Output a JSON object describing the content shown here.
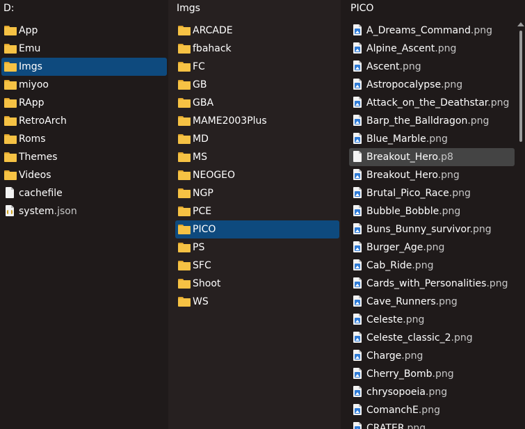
{
  "root": {
    "title": "D:",
    "items": [
      {
        "name": "App",
        "ext": "",
        "type": "folder",
        "state": ""
      },
      {
        "name": "Emu",
        "ext": "",
        "type": "folder",
        "state": ""
      },
      {
        "name": "Imgs",
        "ext": "",
        "type": "folder",
        "state": "selected"
      },
      {
        "name": "miyoo",
        "ext": "",
        "type": "folder",
        "state": ""
      },
      {
        "name": "RApp",
        "ext": "",
        "type": "folder",
        "state": ""
      },
      {
        "name": "RetroArch",
        "ext": "",
        "type": "folder",
        "state": ""
      },
      {
        "name": "Roms",
        "ext": "",
        "type": "folder",
        "state": ""
      },
      {
        "name": "Themes",
        "ext": "",
        "type": "folder",
        "state": ""
      },
      {
        "name": "Videos",
        "ext": "",
        "type": "folder",
        "state": ""
      },
      {
        "name": "cachefile",
        "ext": "",
        "type": "file",
        "state": ""
      },
      {
        "name": "system",
        "ext": ".json",
        "type": "json",
        "state": ""
      }
    ]
  },
  "imgs": {
    "title": "Imgs",
    "items": [
      {
        "name": "ARCADE",
        "ext": "",
        "type": "folder",
        "state": ""
      },
      {
        "name": "fbahack",
        "ext": "",
        "type": "folder",
        "state": ""
      },
      {
        "name": "FC",
        "ext": "",
        "type": "folder",
        "state": ""
      },
      {
        "name": "GB",
        "ext": "",
        "type": "folder",
        "state": ""
      },
      {
        "name": "GBA",
        "ext": "",
        "type": "folder",
        "state": ""
      },
      {
        "name": "MAME2003Plus",
        "ext": "",
        "type": "folder",
        "state": ""
      },
      {
        "name": "MD",
        "ext": "",
        "type": "folder",
        "state": ""
      },
      {
        "name": "MS",
        "ext": "",
        "type": "folder",
        "state": ""
      },
      {
        "name": "NEOGEO",
        "ext": "",
        "type": "folder",
        "state": ""
      },
      {
        "name": "NGP",
        "ext": "",
        "type": "folder",
        "state": ""
      },
      {
        "name": "PCE",
        "ext": "",
        "type": "folder",
        "state": ""
      },
      {
        "name": "PICO",
        "ext": "",
        "type": "folder",
        "state": "selected"
      },
      {
        "name": "PS",
        "ext": "",
        "type": "folder",
        "state": ""
      },
      {
        "name": "SFC",
        "ext": "",
        "type": "folder",
        "state": ""
      },
      {
        "name": "Shoot",
        "ext": "",
        "type": "folder",
        "state": ""
      },
      {
        "name": "WS",
        "ext": "",
        "type": "folder",
        "state": ""
      }
    ]
  },
  "pico": {
    "title": "PICO",
    "items": [
      {
        "name": "A_Dreams_Command",
        "ext": ".png",
        "type": "image",
        "state": ""
      },
      {
        "name": "Alpine_Ascent",
        "ext": ".png",
        "type": "image",
        "state": ""
      },
      {
        "name": "Ascent",
        "ext": ".png",
        "type": "image",
        "state": ""
      },
      {
        "name": "Astropocalypse",
        "ext": ".png",
        "type": "image",
        "state": ""
      },
      {
        "name": "Attack_on_the_Deathstar",
        "ext": ".png",
        "type": "image",
        "state": ""
      },
      {
        "name": "Barp_the_Balldragon",
        "ext": ".png",
        "type": "image",
        "state": ""
      },
      {
        "name": "Blue_Marble",
        "ext": ".png",
        "type": "image",
        "state": ""
      },
      {
        "name": "Breakout_Hero",
        "ext": ".p8",
        "type": "file",
        "state": "hover"
      },
      {
        "name": "Breakout_Hero",
        "ext": ".png",
        "type": "image",
        "state": ""
      },
      {
        "name": "Brutal_Pico_Race",
        "ext": ".png",
        "type": "image",
        "state": ""
      },
      {
        "name": "Bubble_Bobble",
        "ext": ".png",
        "type": "image",
        "state": ""
      },
      {
        "name": "Buns_Bunny_survivor",
        "ext": ".png",
        "type": "image",
        "state": ""
      },
      {
        "name": "Burger_Age",
        "ext": ".png",
        "type": "image",
        "state": ""
      },
      {
        "name": "Cab_Ride",
        "ext": ".png",
        "type": "image",
        "state": ""
      },
      {
        "name": "Cards_with_Personalities",
        "ext": ".png",
        "type": "image",
        "state": ""
      },
      {
        "name": "Cave_Runners",
        "ext": ".png",
        "type": "image",
        "state": ""
      },
      {
        "name": "Celeste",
        "ext": ".png",
        "type": "image",
        "state": ""
      },
      {
        "name": "Celeste_classic_2",
        "ext": ".png",
        "type": "image",
        "state": ""
      },
      {
        "name": "Charge",
        "ext": ".png",
        "type": "image",
        "state": ""
      },
      {
        "name": "Cherry_Bomb",
        "ext": ".png",
        "type": "image",
        "state": ""
      },
      {
        "name": "chrysopoeia",
        "ext": ".png",
        "type": "image",
        "state": ""
      },
      {
        "name": "ComanchE",
        "ext": ".png",
        "type": "image",
        "state": ""
      },
      {
        "name": "CRATER",
        "ext": ".png",
        "type": "image",
        "state": ""
      }
    ],
    "scrollbar": {
      "position": 0.0
    }
  }
}
